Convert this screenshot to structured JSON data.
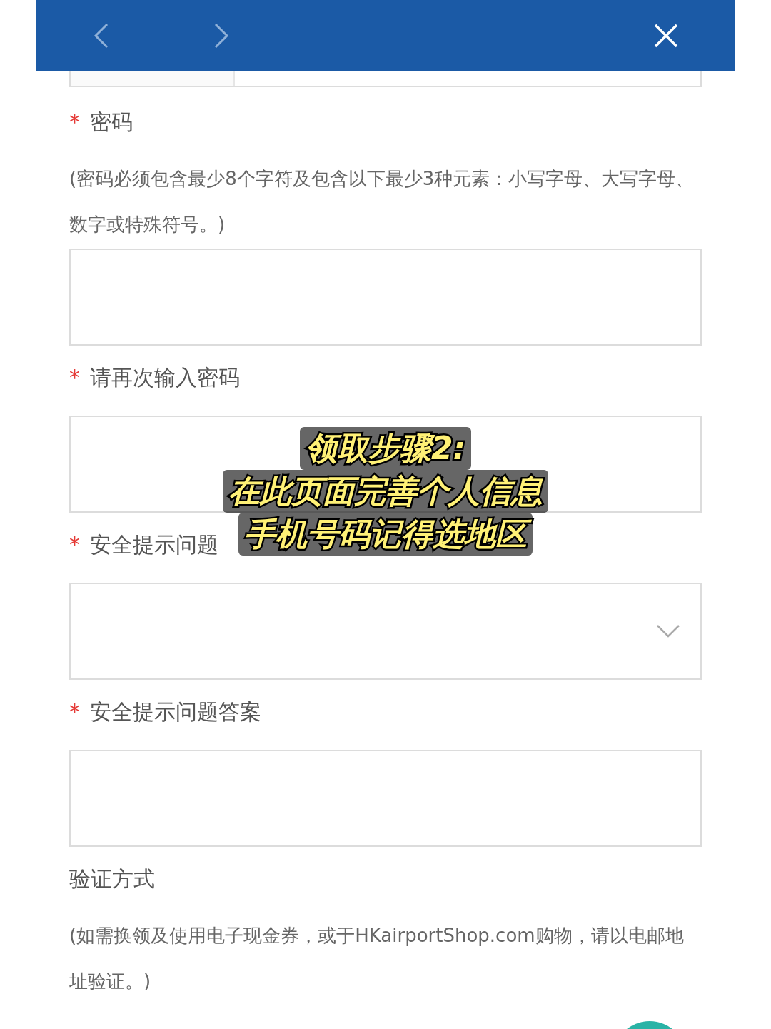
{
  "fields": [
    {
      "required_mark": "*",
      "label": "密码",
      "hint": "(密码必须包含最少8个字符及包含以下最少3种元素：小写字母、大写字母、数字或特殊符号。)",
      "kind": "input"
    },
    {
      "required_mark": "*",
      "label": "请再次输入密码",
      "kind": "input"
    },
    {
      "required_mark": "*",
      "label": "安全提示问题",
      "kind": "select"
    },
    {
      "required_mark": "*",
      "label": "安全提示问题答案",
      "kind": "input"
    },
    {
      "label": "验证方式",
      "hint": "(如需换领及使用电子现金券，或于HKairportShop.com购物，请以电邮地址验证。)",
      "kind": "none"
    }
  ],
  "overlay_caption": [
    "领取步骤2:",
    "在此页面完善个人信息",
    "手机号码记得选地区"
  ]
}
